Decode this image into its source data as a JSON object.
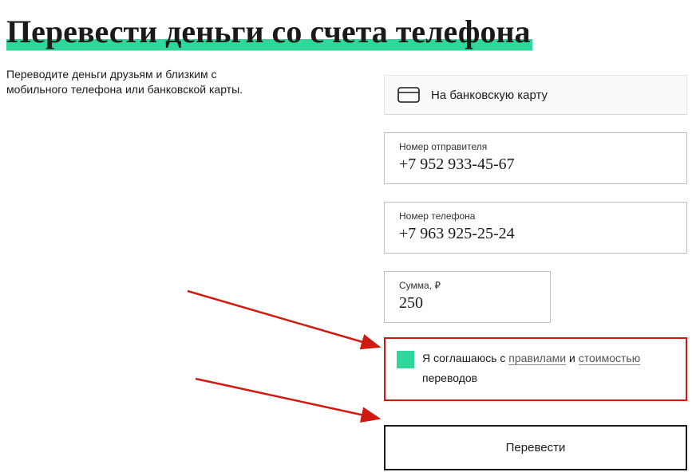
{
  "title": "Перевести деньги со счета телефона",
  "subtitle": "Переводите деньги друзьям и близким с мобильного телефона или банковской карты.",
  "tab": {
    "label": "На банковскую карту"
  },
  "fields": {
    "sender": {
      "label": "Номер отправителя",
      "value": "+7 952 933-45-67"
    },
    "phone": {
      "label": "Номер телефона",
      "value": "+7 963 925-25-24"
    },
    "amount": {
      "label": "Сумма, ₽",
      "value": "250"
    }
  },
  "agreement": {
    "text_prefix": "Я соглашаюсь с ",
    "link_rules": "правилами",
    "text_mid": " и ",
    "link_cost": "стоимостью",
    "text_suffix": "переводов"
  },
  "submit": "Перевести",
  "colors": {
    "accent": "#2fd89a",
    "highlight_border": "#d11a0f"
  }
}
